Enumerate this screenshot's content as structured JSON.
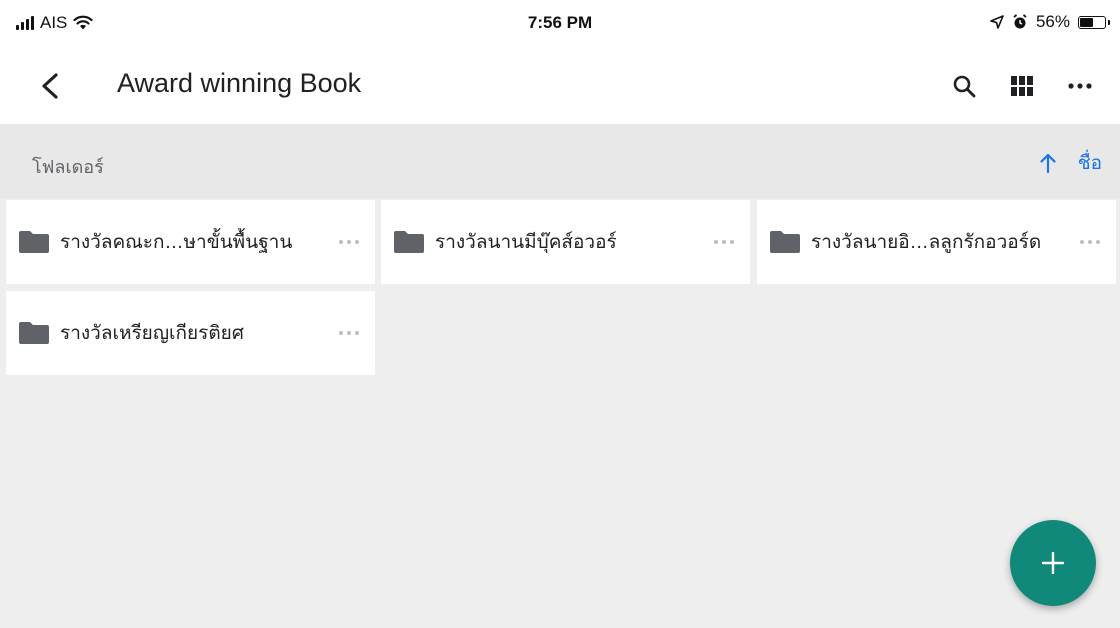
{
  "status_bar": {
    "carrier": "AIS",
    "time": "7:56 PM",
    "battery": "56%",
    "battery_level": 0.56
  },
  "app_bar": {
    "title": "Award winning Book",
    "back_icon": "chevron-left-icon",
    "actions": [
      "search-icon",
      "grid-view-icon",
      "more-horizontal-icon"
    ]
  },
  "sort_bar": {
    "section_label": "โฟลเดอร์",
    "sort_label": "ชื่อ",
    "sort_direction_icon": "arrow-up-icon"
  },
  "folders": [
    {
      "name": "รางวัลคณะก…ษาขั้นพื้นฐาน"
    },
    {
      "name": "รางวัลนานมีบุ๊คส์อวอร์"
    },
    {
      "name": "รางวัลนายอิ…ลลูกรักอวอร์ด"
    },
    {
      "name": "รางวัลเหรียญเกียรติยศ"
    }
  ],
  "fab": {
    "icon": "plus-icon"
  },
  "colors": {
    "accent": "#1a73e8",
    "fab": "#11897a",
    "background": "#eeeeee"
  }
}
